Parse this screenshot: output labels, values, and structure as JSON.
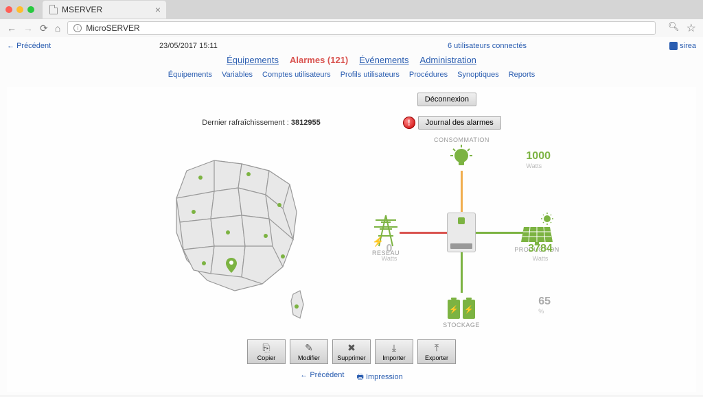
{
  "browser": {
    "tab_title": "MSERVER",
    "url": "MicroSERVER"
  },
  "header": {
    "back": "Précédent",
    "datetime": "23/05/2017 15:11",
    "users_connected": "6 utilisateurs connectés",
    "username": "sirea"
  },
  "main_nav": {
    "equipements": "Équipements",
    "alarmes": "Alarmes (121)",
    "evenements": "Événements",
    "administration": "Administration"
  },
  "sub_nav": [
    "Équipements",
    "Variables",
    "Comptes utilisateurs",
    "Profils utilisateurs",
    "Procédures",
    "Synoptiques",
    "Reports"
  ],
  "buttons": {
    "logout": "Déconnexion",
    "journal_alarmes": "Journal des alarmes"
  },
  "refresh": {
    "label": "Dernier rafraîchissement :",
    "value": "3812955"
  },
  "energy": {
    "consommation": {
      "label": "CONSOMMATION",
      "value": "1000",
      "unit": "Watts"
    },
    "reseau": {
      "label": "RESEAU",
      "value": "0",
      "unit": "Watts"
    },
    "production": {
      "label": "PRODUCTION",
      "value": "3784",
      "unit": "Watts"
    },
    "stockage": {
      "label": "STOCKAGE",
      "value": "65",
      "unit": "%"
    }
  },
  "actions": [
    "Copier",
    "Modifier",
    "Supprimer",
    "Importer",
    "Exporter"
  ],
  "footer": {
    "back": "Précédent",
    "print": "Impression"
  }
}
